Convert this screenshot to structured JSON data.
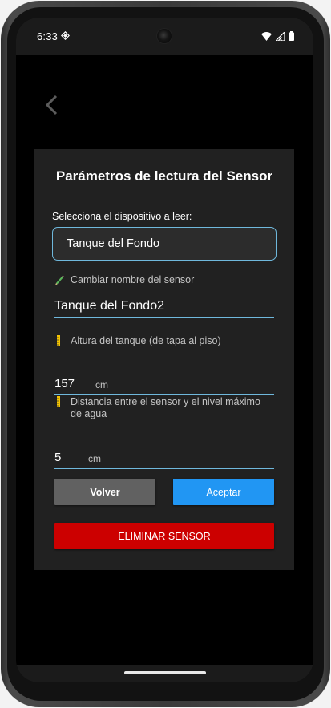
{
  "status_bar": {
    "time": "6:33",
    "icons": [
      "data-saver-icon",
      "wifi-icon",
      "signal-icon",
      "battery-icon"
    ]
  },
  "nav": {
    "back_icon": "chevron-left-icon"
  },
  "dialog": {
    "title": "Parámetros de lectura del Sensor",
    "select_label": "Selecciona el dispositivo a leer:",
    "selected_device": "Tanque del Fondo",
    "rename_label": "Cambiar nombre del sensor",
    "rename_value": "Tanque del Fondo2",
    "height_label": "Altura del tanque (de tapa al piso)",
    "height_value": "157",
    "height_unit": "cm",
    "distance_label": "Distancia entre el sensor y el nivel máximo de agua",
    "distance_value": "5",
    "distance_unit": "cm",
    "back_button": "Volver",
    "accept_button": "Aceptar",
    "delete_button": "ELIMINAR SENSOR"
  },
  "colors": {
    "accent": "#6fb8dc",
    "accept": "#2196f3",
    "back": "#616161",
    "delete": "#cc0000",
    "dialog_bg": "#212121"
  }
}
